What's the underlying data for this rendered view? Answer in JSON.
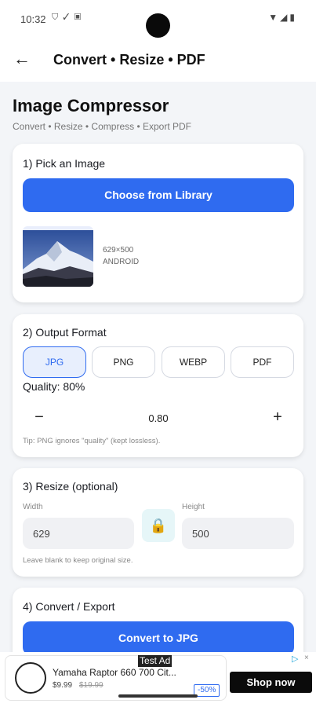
{
  "status_bar": {
    "time": "10:32",
    "left_icons": [
      "shield-icon",
      "check-icon",
      "square-icon"
    ],
    "right_icons": [
      "wifi-icon",
      "signal-icon",
      "battery-icon"
    ]
  },
  "app_bar": {
    "title": "Convert • Resize • PDF",
    "back_icon": "arrow-left-icon"
  },
  "header": {
    "title": "Image Compressor",
    "subtitle": "Convert • Resize • Compress • Export PDF"
  },
  "pick_image": {
    "title": "1) Pick an Image",
    "button_label": "Choose from Library",
    "image_dims": "629×500",
    "image_source": "ANDROID"
  },
  "output_format": {
    "title": "2) Output Format",
    "formats": [
      "JPG",
      "PNG",
      "WEBP",
      "PDF"
    ],
    "selected": "JPG",
    "quality_label": "Quality: 80%",
    "quality_value": "0.80",
    "minus": "−",
    "plus": "+",
    "tip": "Tip: PNG ignores \"quality\" (kept lossless)."
  },
  "resize": {
    "title": "3) Resize (optional)",
    "width_label": "Width",
    "width_value": "629",
    "height_label": "Height",
    "height_value": "500",
    "lock_icon": "lock-icon",
    "help": "Leave blank to keep original size."
  },
  "convert": {
    "title": "4) Convert / Export",
    "button_label": "Convert to JPG"
  },
  "ad": {
    "badge": "Test Ad",
    "title": "Yamaha Raptor 660 700 Cit...",
    "price": "$9.99",
    "old_price": "$19.99",
    "discount": "-50%",
    "cta": "Shop now"
  },
  "colors": {
    "accent": "#2f6bf0",
    "background": "#f3f5f8",
    "card": "#ffffff"
  }
}
